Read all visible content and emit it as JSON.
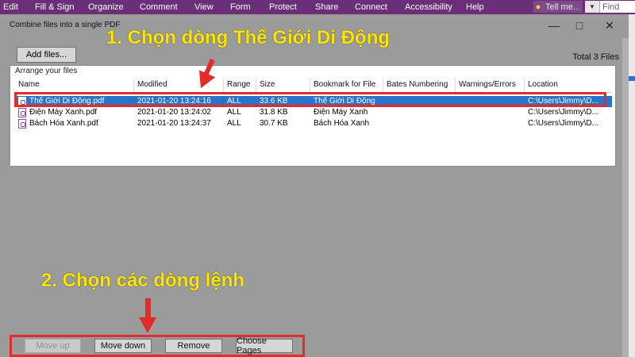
{
  "menubar": {
    "items": [
      "Edit",
      "Fill & Sign",
      "Organize",
      "Comment",
      "View",
      "Form",
      "Protect",
      "Share",
      "Connect",
      "Accessibility",
      "Help"
    ],
    "tell_me": "Tell me...",
    "find": "Find"
  },
  "dialog": {
    "title": "Combine files into a single PDF",
    "add_files_label": "Add files...",
    "total_label": "Total 3 Files",
    "arrange_label": "Arrange your files"
  },
  "table": {
    "columns": [
      "Name",
      "Modified",
      "Range",
      "Size",
      "Bookmark for File",
      "Bates Numbering",
      "Warnings/Errors",
      "Location"
    ],
    "rows": [
      {
        "name": "Thế Giới Di Động.pdf",
        "modified": "2021-01-20 13:24:16",
        "range": "ALL",
        "size": "33.6 KB",
        "bookmark": "Thế Giới Di Động",
        "bates": "",
        "warnings": "",
        "location": "C:\\Users\\Jimmy\\D..."
      },
      {
        "name": "Điện Máy Xanh.pdf",
        "modified": "2021-01-20 13:24:02",
        "range": "ALL",
        "size": "31.8 KB",
        "bookmark": "Điện Máy Xanh",
        "bates": "",
        "warnings": "",
        "location": "C:\\Users\\Jimmy\\D..."
      },
      {
        "name": "Bách Hóa Xanh.pdf",
        "modified": "2021-01-20 13:24:37",
        "range": "ALL",
        "size": "30.7 KB",
        "bookmark": "Bách Hóa Xanh",
        "bates": "",
        "warnings": "",
        "location": "C:\\Users\\Jimmy\\D..."
      }
    ]
  },
  "buttons": {
    "move_up": "Move up",
    "move_down": "Move down",
    "remove": "Remove",
    "choose_pages": "Choose Pages"
  },
  "annotations": {
    "step1": "1. Chọn dòng Thế Giới Di Động",
    "step2": "2. Chọn các dòng lệnh"
  },
  "colors": {
    "menubar": "#6b2f7a",
    "selection": "#2a73c7",
    "annotation_text": "#ffe600",
    "highlight": "#e52a2a"
  }
}
